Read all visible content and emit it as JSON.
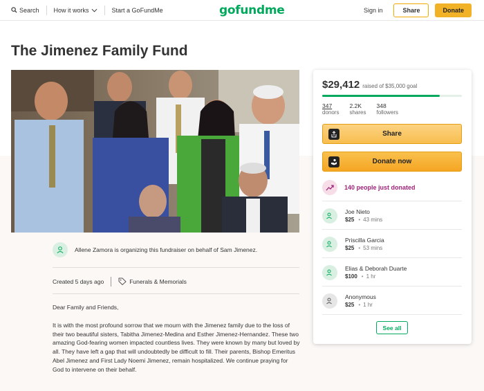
{
  "header": {
    "search_label": "Search",
    "how_it_works_label": "How it works",
    "start_label": "Start a GoFundMe",
    "logo_text": "gofundme",
    "signin_label": "Sign in",
    "share_label": "Share",
    "donate_label": "Donate"
  },
  "campaign": {
    "title": "The Jimenez Family Fund",
    "organizer_text": "Allene Zamora is organizing this fundraiser on behalf of Sam Jimenez.",
    "created": "Created 5 days ago",
    "category": "Funerals & Memorials",
    "story": [
      "Dear Family and Friends,",
      "It is with the most profound sorrow that we mourn with the Jimenez family due to the loss of their two beautiful sisters, Tabitha Jimenez-Medina and Esther Jimenez-Hernandez. These two amazing God-fearing women impacted countless lives. They were known by many but loved by all. They have left a gap that will undoubtedly be difficult to fill. Their parents, Bishop Emeritus Abel Jimenez and First Lady Noemi Jimenez, remain hospitalized. We continue praying for God to intervene on their behalf."
    ]
  },
  "card": {
    "raised": "$29,412",
    "goal_text": "raised of $35,000 goal",
    "progress_fraction": 0.84,
    "donors_count": "347",
    "donors_label": "donors",
    "shares_count": "2.2K",
    "shares_label": "shares",
    "followers_count": "348",
    "followers_label": "followers",
    "share_button": "Share",
    "donate_button": "Donate now",
    "recent_text": "140 people just donated",
    "donations": [
      {
        "name": "Joe Nieto",
        "amount": "$25",
        "time": "43 mins"
      },
      {
        "name": "Priscilla Garcia",
        "amount": "$25",
        "time": "53 mins"
      },
      {
        "name": "Elias & Deborah Duarte",
        "amount": "$100",
        "time": "1 hr"
      },
      {
        "name": "Anonymous",
        "amount": "$25",
        "time": "1 hr"
      }
    ],
    "see_all": "See all"
  },
  "colors": {
    "brand_green": "#02a95c",
    "donate_orange": "#f5a623",
    "recent_purple": "#a0237a"
  }
}
